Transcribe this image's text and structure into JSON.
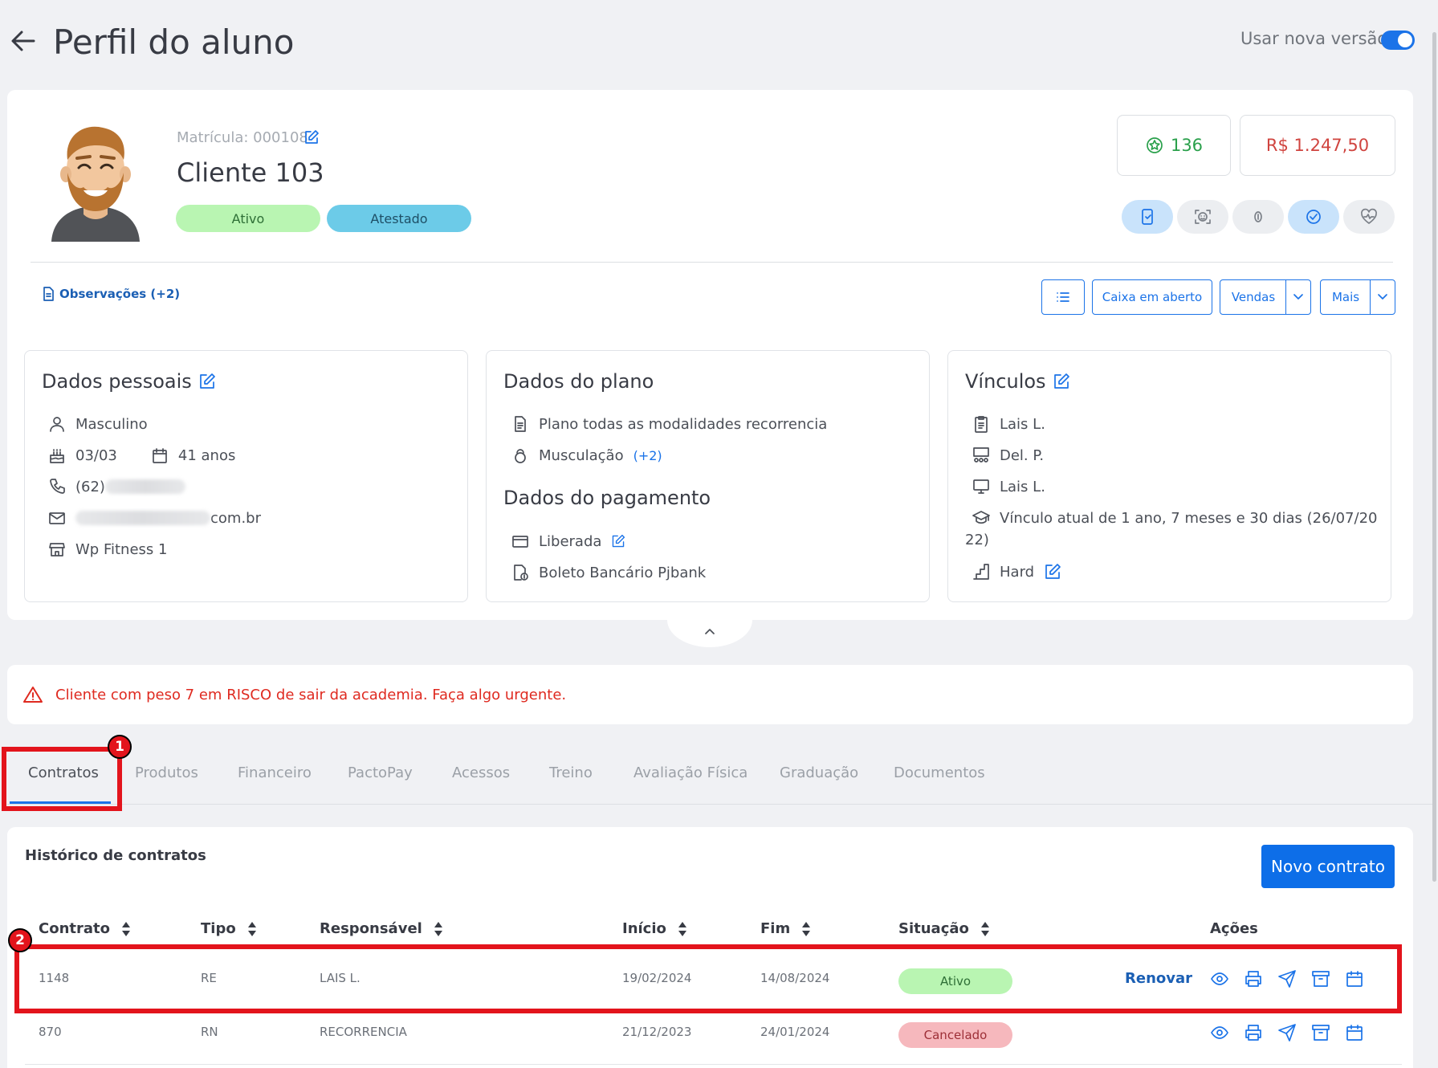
{
  "header": {
    "title": "Perfil do aluno",
    "new_version_label": "Usar nova versão"
  },
  "profile": {
    "matricula": "Matrícula: 000108",
    "name": "Cliente 103",
    "badges": [
      "Ativo",
      "Atestado"
    ],
    "points": "136",
    "balance": "R$ 1.247,50",
    "observations": "Observações (+2)"
  },
  "toolbar": {
    "caixa": "Caixa em aberto",
    "vendas": "Vendas",
    "mais": "Mais"
  },
  "dados_pessoais": {
    "title": "Dados pessoais",
    "gender": "Masculino",
    "birthday": "03/03",
    "age": "41 anos",
    "phone_prefix": "(62)",
    "email_suffix": "com.br",
    "unit": "Wp Fitness 1"
  },
  "dados_plano": {
    "title": "Dados do plano",
    "plan": "Plano todas as modalidades recorrencia",
    "modality": "Musculação",
    "modality_more": "(+2)"
  },
  "dados_pagamento": {
    "title": "Dados do pagamento",
    "status": "Liberada",
    "method": "Boleto Bancário Pjbank"
  },
  "vinculos": {
    "title": "Vínculos",
    "consultor": "Lais L.",
    "professor": "Del. P.",
    "terminal": "Lais L.",
    "vinculo_line1": "Vínculo atual de 1 ano, 7 meses e 30 dias (26/07/20",
    "vinculo_line2": "22)",
    "nivel": "Hard"
  },
  "alert": {
    "text": "Cliente com peso 7 em RISCO de sair da academia. Faça algo urgente."
  },
  "tabs": [
    "Contratos",
    "Produtos",
    "Financeiro",
    "PactoPay",
    "Acessos",
    "Treino",
    "Avaliação Física",
    "Graduação",
    "Documentos"
  ],
  "markers": [
    "1",
    "2"
  ],
  "contracts": {
    "title": "Histórico de contratos",
    "new_button": "Novo contrato",
    "columns": [
      "Contrato",
      "Tipo",
      "Responsável",
      "Início",
      "Fim",
      "Situação",
      "Ações"
    ],
    "renew_label": "Renovar",
    "rows": [
      {
        "contrato": "1148",
        "tipo": "RE",
        "responsavel": "LAIS L.",
        "inicio": "19/02/2024",
        "fim": "14/08/2024",
        "situacao": "Ativo"
      },
      {
        "contrato": "870",
        "tipo": "RN",
        "responsavel": "RECORRENCIA",
        "inicio": "21/12/2023",
        "fim": "24/01/2024",
        "situacao": "Cancelado"
      }
    ]
  },
  "colors": {
    "accent": "#1b73e8",
    "ativo_bg": "#b9f5b2",
    "atestado_bg": "#6ccbe8",
    "cancelado_bg": "#f6b8bd",
    "alert": "#df2a20",
    "points": "#2aa04b",
    "balance": "#d0443f",
    "annotation": "#e3141c"
  }
}
